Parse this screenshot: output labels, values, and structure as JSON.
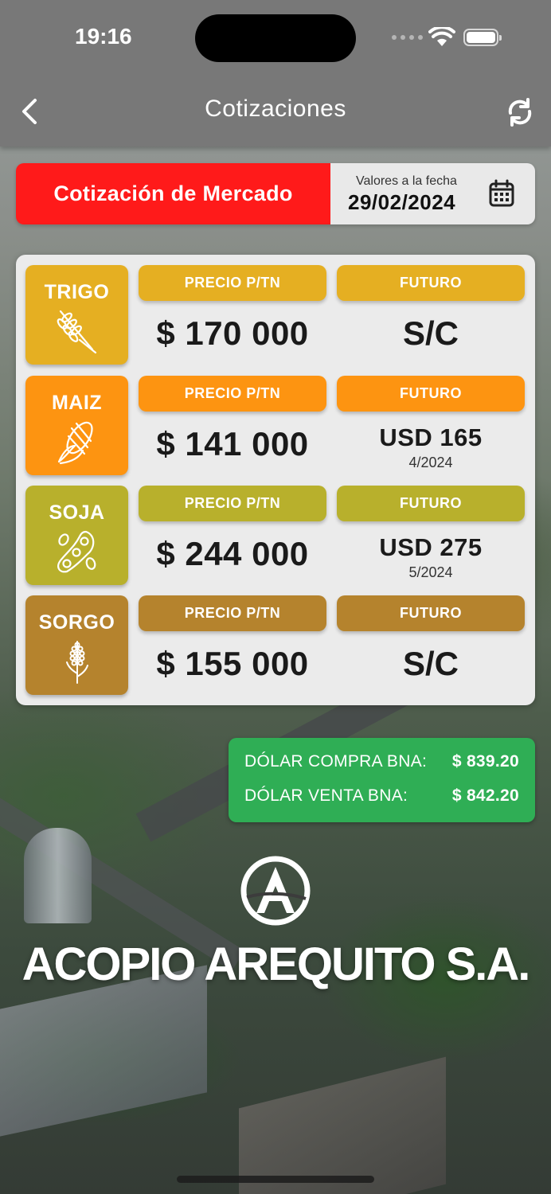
{
  "status_bar": {
    "time": "19:16"
  },
  "nav": {
    "title": "Cotizaciones",
    "back_icon": "chevron-left-icon",
    "refresh_icon": "refresh-icon"
  },
  "header": {
    "market_label": "Cotización de Mercado",
    "date_caption": "Valores a la fecha",
    "date_value": "29/02/2024",
    "calendar_icon": "calendar-icon",
    "accent_color": "#ff1a1a"
  },
  "grains": [
    {
      "name": "TRIGO",
      "icon": "wheat-icon",
      "color": "#e5af22",
      "price_label": "PRECIO P/TN",
      "price": "$ 170 000",
      "future_label": "FUTURO",
      "future": "S/C",
      "future_date": ""
    },
    {
      "name": "MAIZ",
      "icon": "corn-icon",
      "color": "#fd9411",
      "price_label": "PRECIO P/TN",
      "price": "$ 141 000",
      "future_label": "FUTURO",
      "future": "USD 165",
      "future_date": "4/2024"
    },
    {
      "name": "SOJA",
      "icon": "soybean-icon",
      "color": "#b8b02c",
      "price_label": "PRECIO P/TN",
      "price": "$ 244 000",
      "future_label": "FUTURO",
      "future": "USD 275",
      "future_date": "5/2024"
    },
    {
      "name": "SORGO",
      "icon": "sorghum-icon",
      "color": "#b5832d",
      "price_label": "PRECIO P/TN",
      "price": "$ 155 000",
      "future_label": "FUTURO",
      "future": "S/C",
      "future_date": ""
    }
  ],
  "dollar": {
    "buy_label": "DÓLAR COMPRA BNA:",
    "buy_value": "$ 839.20",
    "sell_label": "DÓLAR VENTA BNA:",
    "sell_value": "$ 842.20",
    "color": "#2fae55"
  },
  "company": {
    "name": "ACOPIO AREQUITO S.A.",
    "logo_icon": "company-logo-icon"
  }
}
